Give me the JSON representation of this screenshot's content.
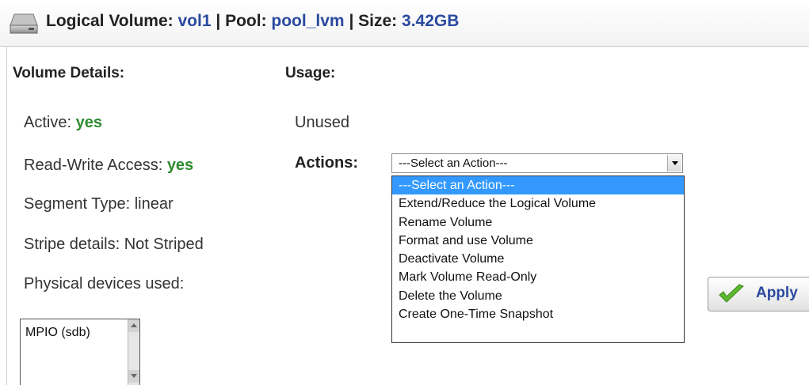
{
  "header": {
    "lv_label": "Logical Volume:",
    "lv_value": "vol1",
    "pool_label": "| Pool:",
    "pool_value": "pool_lvm",
    "size_label": "| Size:",
    "size_value": "3.42GB",
    "icon": "hard-drive-icon"
  },
  "details": {
    "title": "Volume Details:",
    "active_label": "Active:",
    "active_value": "yes",
    "rw_label": "Read-Write Access:",
    "rw_value": "yes",
    "segment": "Segment Type: linear",
    "stripe": "Stripe details: Not Striped",
    "pdev_label": "Physical devices used:",
    "pdev_items": [
      "MPIO (sdb)"
    ]
  },
  "usage": {
    "title": "Usage:",
    "value": "Unused"
  },
  "actions": {
    "label": "Actions:",
    "selected": "---Select an Action---",
    "options": [
      "---Select an Action---",
      "Extend/Reduce the Logical Volume",
      "Rename Volume",
      "Format and use Volume",
      "Deactivate Volume",
      "Mark Volume Read-Only",
      "Delete the Volume",
      "Create One-Time Snapshot"
    ]
  },
  "apply": {
    "label": "Apply",
    "icon": "checkmark-icon"
  },
  "colors": {
    "accent_blue": "#2a4aa0",
    "ok_green": "#2e8b2e",
    "highlight": "#3399ff"
  }
}
